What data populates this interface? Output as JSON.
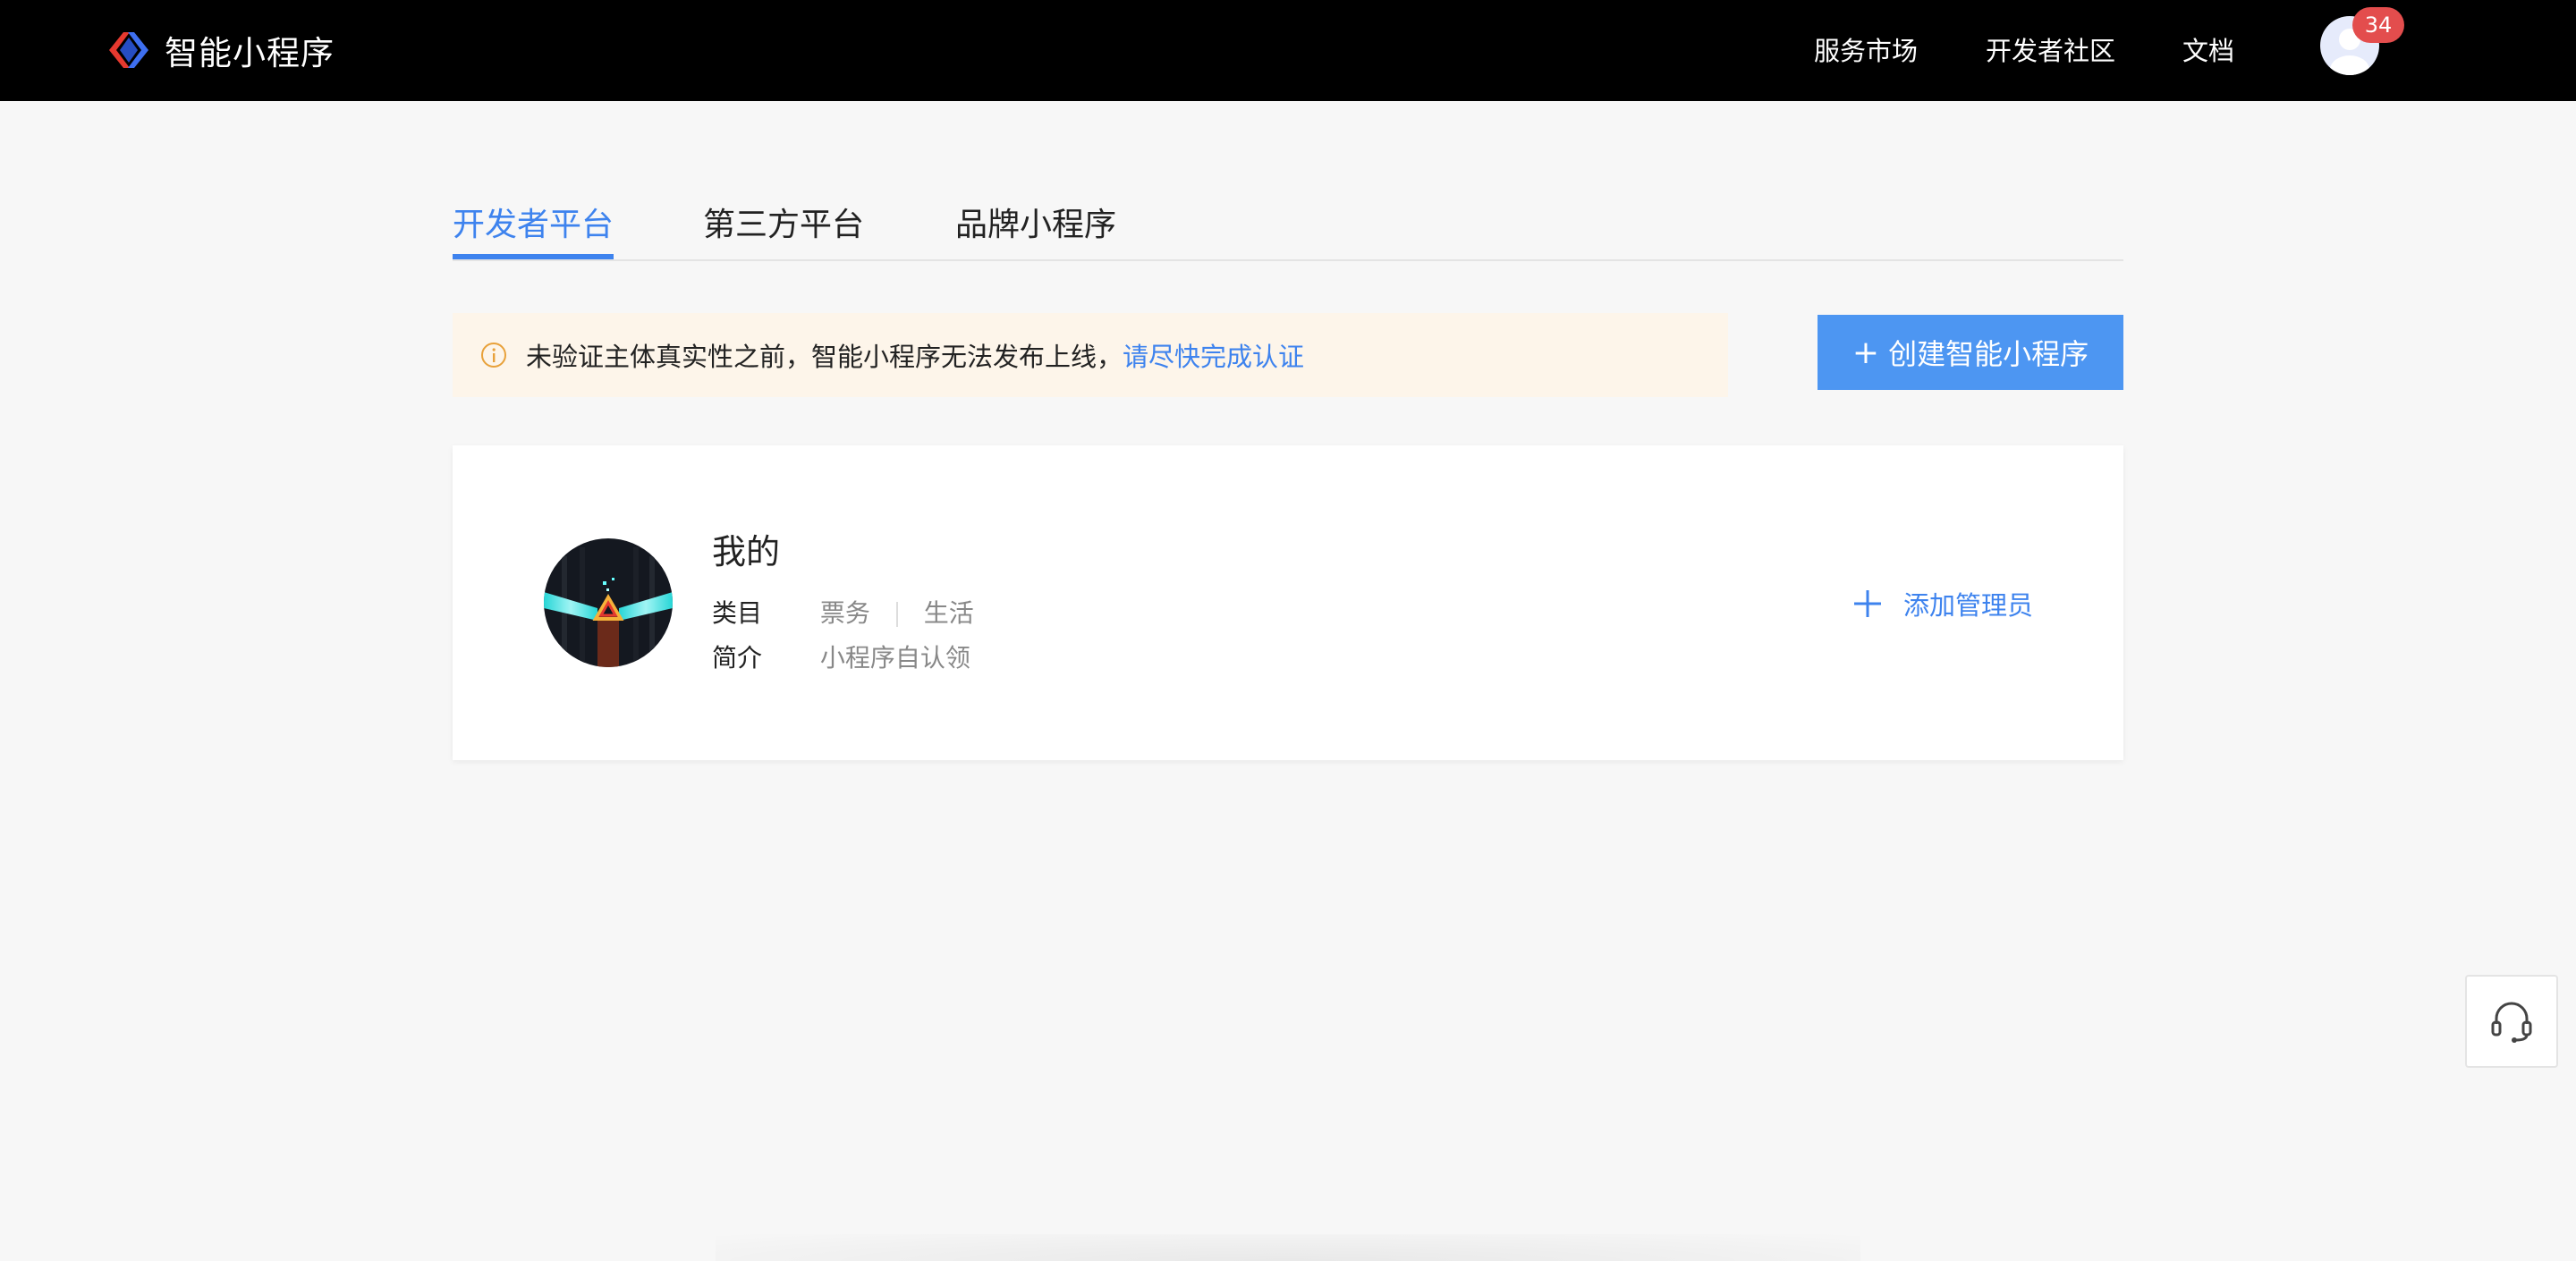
{
  "header": {
    "app_title": "智能小程序",
    "nav": {
      "service_market": "服务市场",
      "developer_community": "开发者社区",
      "docs": "文档"
    },
    "notification_count": "34"
  },
  "tabs": [
    {
      "label": "开发者平台",
      "active": true
    },
    {
      "label": "第三方平台",
      "active": false
    },
    {
      "label": "品牌小程序",
      "active": false
    }
  ],
  "notice": {
    "text": "未验证主体真实性之前，智能小程序无法发布上线，",
    "link": "请尽快完成认证"
  },
  "create_button": {
    "plus": "+",
    "label": "创建智能小程序"
  },
  "app_card": {
    "name": "我的",
    "category_label": "类目",
    "categories": [
      "票务",
      "生活"
    ],
    "intro_label": "简介",
    "intro": "小程序自认领",
    "add_admin_label": "添加管理员"
  },
  "colors": {
    "header_bg": "#000000",
    "accent": "#3e83ee",
    "button_bg": "#4d96f2",
    "notice_bg": "#fdf5ea",
    "badge": "#e34d4d"
  }
}
